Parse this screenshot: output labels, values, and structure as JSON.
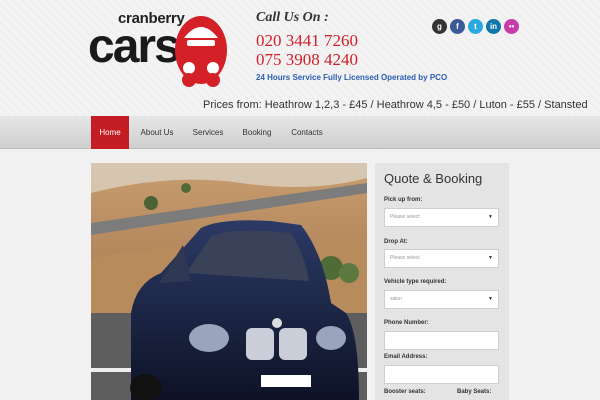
{
  "header": {
    "logo_top": "cranberry",
    "logo_main": "cars",
    "call_label": "Call Us On :",
    "phone_1": "020 3441 7260",
    "phone_2": "075 3908 4240",
    "tagline": "24 Hours Service Fully Licensed Operated by PCO",
    "prices": "Prices from: Heathrow 1,2,3 - £45 / Heathrow 4,5 - £50 / Luton - £55 / Stansted",
    "social": [
      {
        "icon": "google-icon",
        "glyph": "g",
        "color": "#333333"
      },
      {
        "icon": "facebook-icon",
        "glyph": "f",
        "color": "#3b5998"
      },
      {
        "icon": "twitter-icon",
        "glyph": "t",
        "color": "#29a9e0"
      },
      {
        "icon": "linkedin-icon",
        "glyph": "in",
        "color": "#0e76a8"
      },
      {
        "icon": "flickr-icon",
        "glyph": "••",
        "color": "#c93ba9"
      }
    ]
  },
  "nav": {
    "home": "Home",
    "about": "About Us",
    "services": "Services",
    "booking": "Booking",
    "contacts": "Contacts",
    "active_color": "#c41e24"
  },
  "quote": {
    "title": "Quote & Booking",
    "pickup_label": "Pick up from:",
    "pickup_value": "Please select",
    "drop_label": "Drop At:",
    "drop_value": "Please select",
    "vehicle_label": "Vehicle type required:",
    "vehicle_value": "salon",
    "phone_label": "Phone Number:",
    "email_label": "Email Address:",
    "booster_label": "Booster seats:",
    "baby_label": "Baby Seats:"
  },
  "colors": {
    "brand_red": "#d0202b",
    "link_blue": "#2b5fb3"
  }
}
